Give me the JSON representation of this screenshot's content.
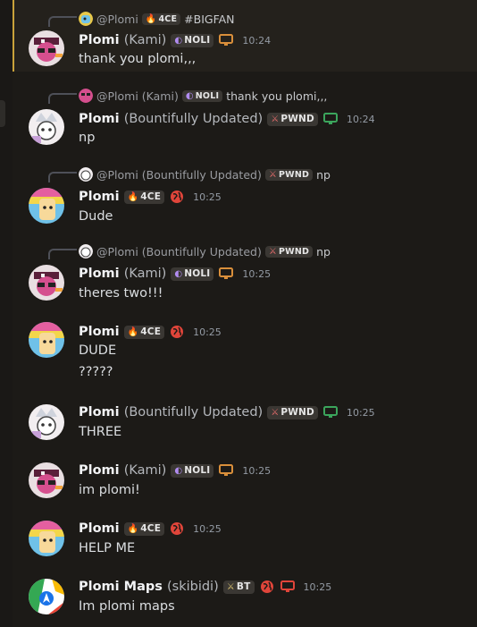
{
  "messages": [
    {
      "reply": {
        "author": "@Plomi",
        "nick": "",
        "tag": "4CE",
        "tag_icon": "fire",
        "text": "#BIGFAN"
      },
      "author": "Plomi",
      "nick": "(Kami)",
      "tag": "NOLI",
      "tag_icon": "moon",
      "status_icon": "desktop",
      "time": "10:24",
      "lines": [
        "thank you plomi,,,"
      ]
    },
    {
      "reply": {
        "author": "@Plomi",
        "nick": "(Kami)",
        "tag": "NOLI",
        "tag_icon": "moon",
        "text": "thank you plomi,,,"
      },
      "author": "Plomi",
      "nick": "(Bountifully Updated)",
      "tag": "PWND",
      "tag_icon": "sword",
      "status_icon": "desktop",
      "time": "10:24",
      "lines": [
        "np"
      ]
    },
    {
      "reply": {
        "author": "@Plomi",
        "nick": "(Bountifully Updated)",
        "tag": "PWND",
        "tag_icon": "sword",
        "text": "np"
      },
      "author": "Plomi",
      "nick": "",
      "tag": "4CE",
      "tag_icon": "fire",
      "status_icon": "globe",
      "time": "10:25",
      "lines": [
        "Dude"
      ]
    },
    {
      "reply": {
        "author": "@Plomi",
        "nick": "(Bountifully Updated)",
        "tag": "PWND",
        "tag_icon": "sword",
        "text": "np"
      },
      "author": "Plomi",
      "nick": "(Kami)",
      "tag": "NOLI",
      "tag_icon": "moon",
      "status_icon": "desktop",
      "time": "10:25",
      "lines": [
        "theres two!!!"
      ]
    },
    {
      "author": "Plomi",
      "nick": "",
      "tag": "4CE",
      "tag_icon": "fire",
      "status_icon": "globe",
      "time": "10:25",
      "lines": [
        "DUDE",
        "?????"
      ]
    },
    {
      "author": "Plomi",
      "nick": "(Bountifully Updated)",
      "tag": "PWND",
      "tag_icon": "sword",
      "status_icon": "desktop",
      "time": "10:25",
      "lines": [
        "THREE"
      ]
    },
    {
      "author": "Plomi",
      "nick": "(Kami)",
      "tag": "NOLI",
      "tag_icon": "moon",
      "status_icon": "desktop",
      "time": "10:25",
      "lines": [
        "im plomi!"
      ]
    },
    {
      "author": "Plomi",
      "nick": "",
      "tag": "4CE",
      "tag_icon": "fire",
      "status_icon": "globe",
      "time": "10:25",
      "lines": [
        "HELP ME"
      ]
    },
    {
      "author": "Plomi Maps",
      "nick": "(skibidi)",
      "tag": "BT",
      "tag_icon": "sword",
      "status_icon": "globe+desktop",
      "time": "10:25",
      "lines": [
        "Im plomi maps"
      ]
    }
  ],
  "colors": {
    "background": "#1c1a17",
    "highlight": "#24211c",
    "highlight_bar": "#c9a23a",
    "status_orange": "#d98f3b",
    "status_green": "#3ba55c",
    "status_red": "#e0453a"
  }
}
